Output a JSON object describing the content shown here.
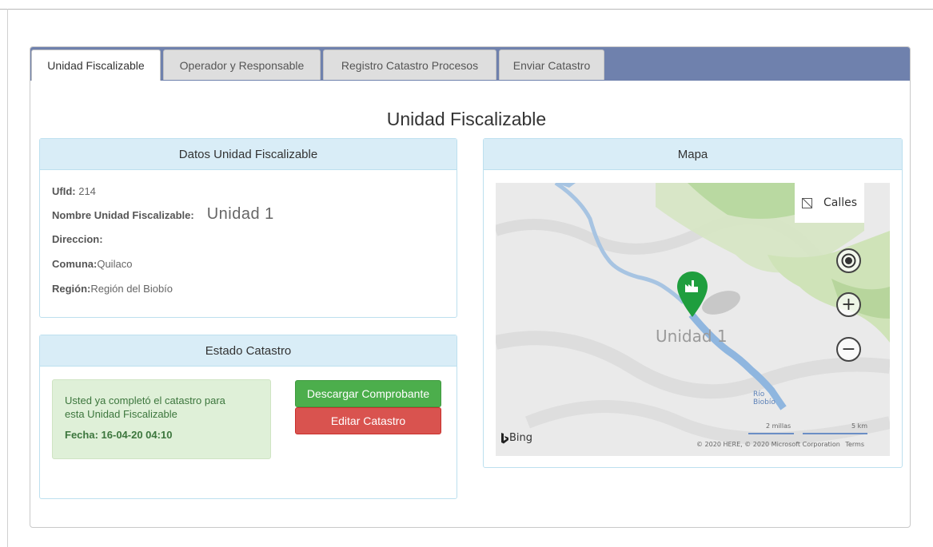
{
  "tabs": [
    {
      "label": "Unidad Fiscalizable",
      "active": true
    },
    {
      "label": "Operador y Responsable",
      "active": false
    },
    {
      "label": "Registro Catastro Procesos",
      "active": false
    },
    {
      "label": "Enviar Catastro",
      "active": false
    }
  ],
  "page_title": "Unidad Fiscalizable",
  "datos": {
    "header": "Datos Unidad Fiscalizable",
    "ufid_label": "UfId:",
    "ufid_value": " 214",
    "nombre_label": "Nombre Unidad Fiscalizable:",
    "nombre_value": "Unidad 1",
    "direccion_label": "Direccion:",
    "comuna_label": "Comuna:",
    "comuna_value": "Quilaco",
    "region_label": "Región:",
    "region_value": "Región del Biobío"
  },
  "estado": {
    "header": "Estado Catastro",
    "message_line1": "Usted ya completó el catastro para",
    "message_line2": "esta Unidad Fiscalizable",
    "fecha_label": "Fecha:",
    "fecha_value": "16-04-20 04:10",
    "download_button": "Descargar Comprobante",
    "edit_button": "Editar Catastro"
  },
  "mapa": {
    "header": "Mapa",
    "layer_label": "Calles",
    "pin_label": "Unidad 1",
    "river_label_line1": "Río",
    "river_label_line2": "Biobío",
    "scale_miles": "2 millas",
    "scale_km": "5 km",
    "bing_label": "Bing",
    "copyright": "© 2020 HERE, © 2020 Microsoft Corporation",
    "terms": "Terms",
    "icons": [
      "locate-me-icon",
      "zoom-in-icon",
      "zoom-out-icon",
      "factory-pin-icon",
      "bing-logo-icon"
    ]
  },
  "colors": {
    "tab_bar": "#6f81ad",
    "card_header": "#d9edf7",
    "success_alert": "#dff0d8",
    "button_green": "#4cae4c",
    "button_red": "#d9534f",
    "pin_green": "#1f9e3e"
  }
}
